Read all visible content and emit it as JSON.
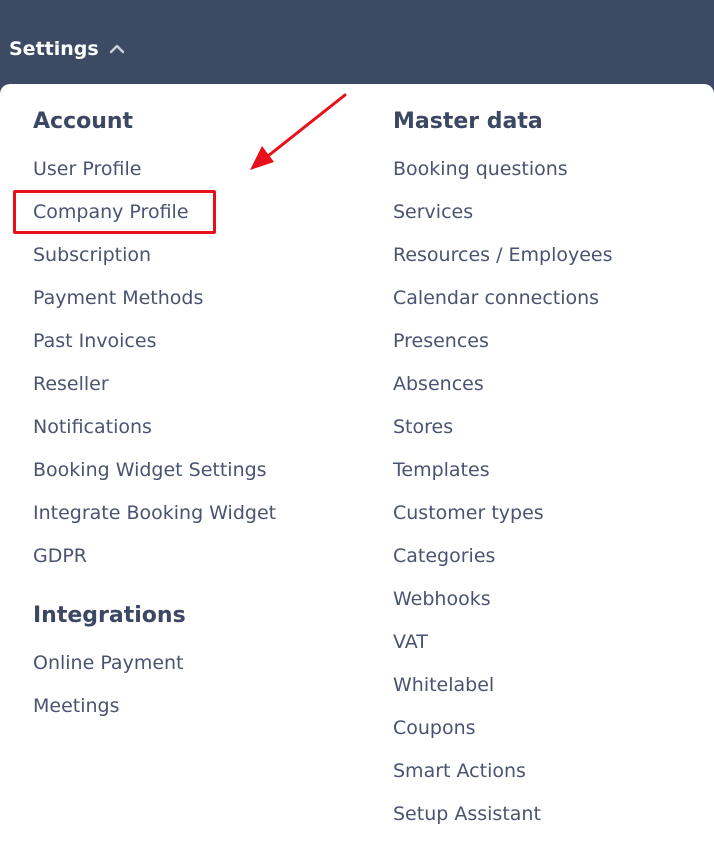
{
  "header": {
    "settings_label": "Settings",
    "settings_icon": "chevron-up-icon"
  },
  "account": {
    "heading": "Account",
    "items": [
      {
        "label": "User Profile"
      },
      {
        "label": "Company Profile"
      },
      {
        "label": "Subscription"
      },
      {
        "label": "Payment Methods"
      },
      {
        "label": "Past Invoices"
      },
      {
        "label": "Reseller"
      },
      {
        "label": "Notifications"
      },
      {
        "label": "Booking Widget Settings"
      },
      {
        "label": "Integrate Booking Widget"
      },
      {
        "label": "GDPR"
      }
    ]
  },
  "integrations": {
    "heading": "Integrations",
    "items": [
      {
        "label": "Online Payment"
      },
      {
        "label": "Meetings"
      }
    ]
  },
  "master_data": {
    "heading": "Master data",
    "items": [
      {
        "label": "Booking questions"
      },
      {
        "label": "Services"
      },
      {
        "label": "Resources / Employees"
      },
      {
        "label": "Calendar connections"
      },
      {
        "label": "Presences"
      },
      {
        "label": "Absences"
      },
      {
        "label": "Stores"
      },
      {
        "label": "Templates"
      },
      {
        "label": "Customer types"
      },
      {
        "label": "Categories"
      },
      {
        "label": "Webhooks"
      },
      {
        "label": "VAT"
      },
      {
        "label": "Whitelabel"
      },
      {
        "label": "Coupons"
      },
      {
        "label": "Smart Actions"
      },
      {
        "label": "Setup Assistant"
      }
    ]
  },
  "annotation": {
    "highlighted_item": "Company Profile",
    "color": "#e8101a"
  }
}
